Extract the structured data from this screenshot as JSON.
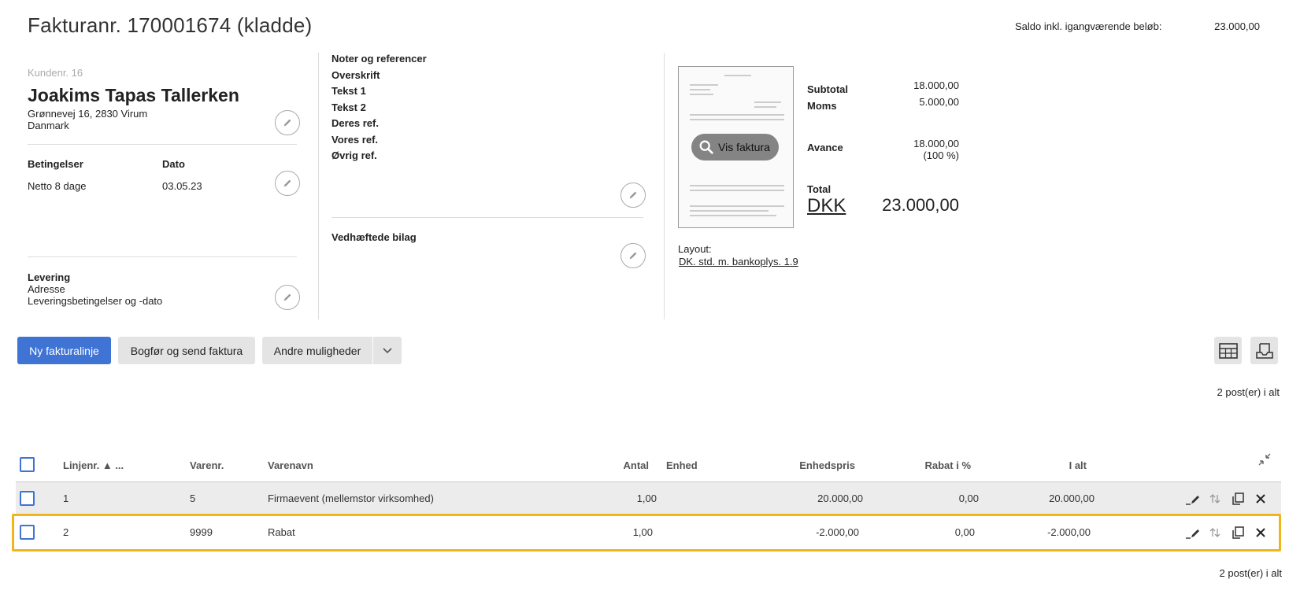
{
  "header": {
    "title": "Fakturanr. 170001674 (kladde)",
    "saldo_label": "Saldo inkl. igangværende beløb:",
    "saldo_value": "23.000,00"
  },
  "customer": {
    "kunde_nr": "Kundenr. 16",
    "name": "Joakims Tapas Tallerken",
    "address_line": "Grønnevej 16, 2830 Virum",
    "country": "Danmark"
  },
  "terms": {
    "betingelser_label": "Betingelser",
    "betingelser_value": "Netto 8 dage",
    "dato_label": "Dato",
    "dato_value": "03.05.23"
  },
  "delivery": {
    "label": "Levering",
    "adresse": "Adresse",
    "conditions": "Leveringsbetingelser og -dato"
  },
  "notes": {
    "items": [
      "Noter og referencer",
      "Overskrift",
      "Tekst 1",
      "Tekst 2",
      "Deres ref.",
      "Vores ref.",
      "Øvrig ref."
    ],
    "attachments_label": "Vedhæftede bilag"
  },
  "preview": {
    "button_label": "Vis faktura",
    "layout_label": "Layout:",
    "layout_value": "DK. std. m. bankoplys. 1.9"
  },
  "totals": {
    "subtotal_label": "Subtotal",
    "subtotal_value": "18.000,00",
    "moms_label": "Moms",
    "moms_value": "5.000,00",
    "avance_label": "Avance",
    "avance_value": "18.000,00",
    "avance_pct": "(100 %)",
    "total_label": "Total",
    "currency": "DKK",
    "total_value": "23.000,00"
  },
  "toolbar": {
    "new_line": "Ny fakturalinje",
    "book_send": "Bogfør og send faktura",
    "other": "Andre muligheder"
  },
  "count_text": "2 post(er) i alt",
  "table": {
    "headers": {
      "linjenr": "Linjenr. ▲ ...",
      "varenr": "Varenr.",
      "varenavn": "Varenavn",
      "antal": "Antal",
      "enhed": "Enhed",
      "enhedspris": "Enhedspris",
      "rabat": "Rabat i %",
      "ialt": "I alt"
    },
    "rows": [
      {
        "linjenr": "1",
        "varenr": "5",
        "varenavn": "Firmaevent (mellemstor virksomhed)",
        "antal": "1,00",
        "enhed": "",
        "enhedspris": "20.000,00",
        "rabat": "0,00",
        "ialt": "20.000,00"
      },
      {
        "linjenr": "2",
        "varenr": "9999",
        "varenavn": "Rabat",
        "antal": "1,00",
        "enhed": "",
        "enhedspris": "-2.000,00",
        "rabat": "0,00",
        "ialt": "-2.000,00"
      }
    ]
  },
  "colors": {
    "primary": "#3f74d4",
    "highlight": "#f0b619"
  }
}
